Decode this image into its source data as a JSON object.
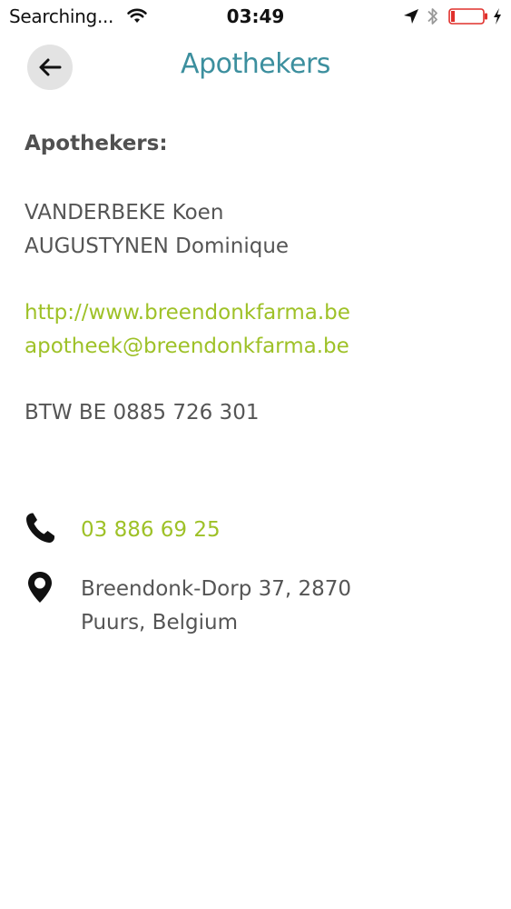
{
  "status_bar": {
    "carrier": "Searching...",
    "time": "03:49",
    "icons": [
      "wifi-icon",
      "location-arrow-icon",
      "bluetooth-icon",
      "battery-icon",
      "charging-icon"
    ],
    "battery_color": "#e0302c"
  },
  "nav": {
    "back_icon": "arrow-left-icon",
    "title": "Apothekers",
    "title_color": "#3c8f9e"
  },
  "content": {
    "heading": "Apothekers:",
    "pharmacists": [
      "VANDERBEKE Koen",
      "AUGUSTYNEN Dominique"
    ],
    "website": "http://www.breendonkfarma.be",
    "email": "apotheek@breendonkfarma.be",
    "vat": "BTW BE 0885 726 301",
    "link_color": "#9ec127"
  },
  "contact": {
    "phone_icon": "phone-icon",
    "phone": "03 886 69 25",
    "address_icon": "map-pin-icon",
    "address_line1": "Breendonk-Dorp 37, 2870",
    "address_line2": "Puurs, Belgium"
  }
}
